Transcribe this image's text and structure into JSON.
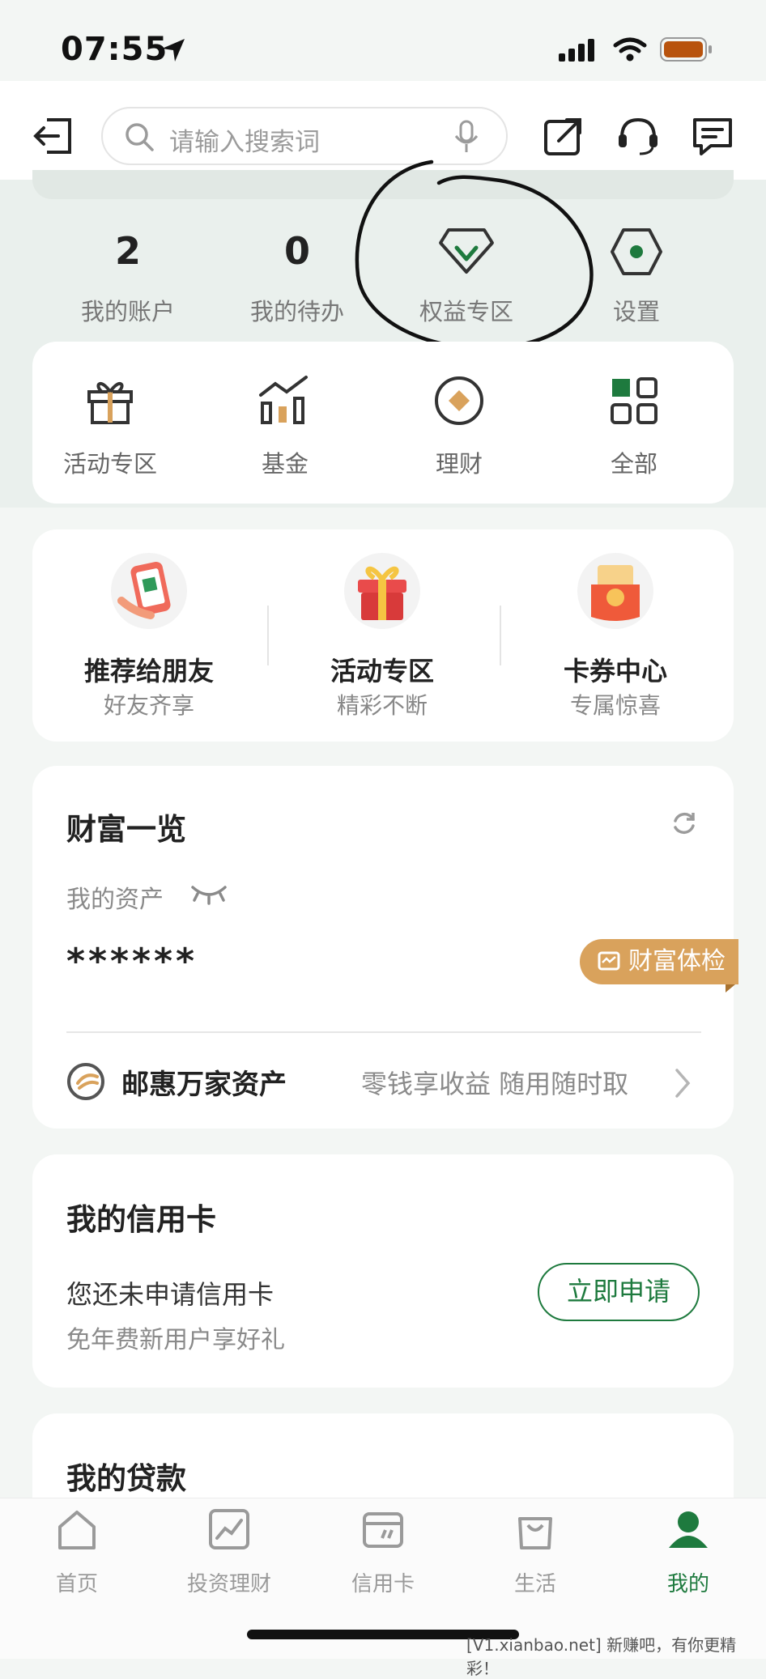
{
  "status_bar": {
    "time": "07:55"
  },
  "header": {
    "search_placeholder": "请输入搜索词"
  },
  "stats": [
    {
      "value": "2",
      "label": "我的账户"
    },
    {
      "value": "0",
      "label": "我的待办"
    }
  ],
  "quick": [
    {
      "label": "权益专区",
      "icon": "diamond-icon"
    },
    {
      "label": "设置",
      "icon": "gear-icon"
    }
  ],
  "grid": [
    {
      "label": "活动专区",
      "icon": "gift-icon"
    },
    {
      "label": "基金",
      "icon": "fund-chart-icon"
    },
    {
      "label": "理财",
      "icon": "wealth-coin-icon"
    },
    {
      "label": "全部",
      "icon": "all-grid-icon"
    }
  ],
  "promos": [
    {
      "title": "推荐给朋友",
      "subtitle": "好友齐享"
    },
    {
      "title": "活动专区",
      "subtitle": "精彩不断"
    },
    {
      "title": "卡券中心",
      "subtitle": "专属惊喜"
    }
  ],
  "wealth": {
    "title": "财富一览",
    "assets_label": "我的资产",
    "masked_value": "******",
    "checkup_label": "财富体检",
    "product_name": "邮惠万家资产",
    "product_desc": "零钱享收益 随用随时取"
  },
  "credit": {
    "title": "我的信用卡",
    "line1": "您还未申请信用卡",
    "line2": "免年费新用户享好礼",
    "apply_label": "立即申请"
  },
  "loan": {
    "title": "我的贷款"
  },
  "tabbar": [
    {
      "label": "首页",
      "icon": "home-icon"
    },
    {
      "label": "投资理财",
      "icon": "invest-chart-icon"
    },
    {
      "label": "信用卡",
      "icon": "card-icon"
    },
    {
      "label": "生活",
      "icon": "shopping-bag-icon"
    },
    {
      "label": "我的",
      "icon": "user-icon",
      "active": true
    }
  ],
  "watermark": "[V1.xianbao.net] 新赚吧，有你更精彩！",
  "colors": {
    "accent": "#1e7a3e",
    "badge": "#d9a25c"
  }
}
